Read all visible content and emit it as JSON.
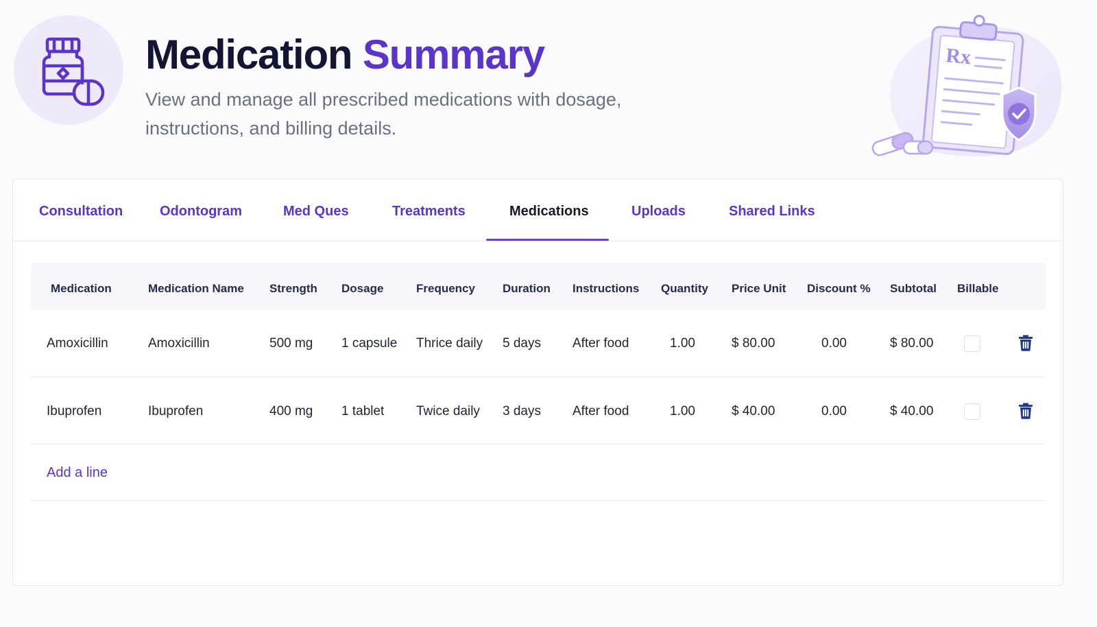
{
  "header": {
    "title_main": "Medication",
    "title_accent": "Summary",
    "subtitle": "View and manage all prescribed medications with dosage, instructions, and billing details.",
    "rx_symbol": "Rx",
    "icons": {
      "badge": "medicine-bottle-icon",
      "illustration": "prescription-clipboard-icon"
    }
  },
  "tabs": [
    {
      "label": "Consultation",
      "active": false
    },
    {
      "label": "Odontogram",
      "active": false
    },
    {
      "label": "Med Ques",
      "active": false
    },
    {
      "label": "Treatments",
      "active": false
    },
    {
      "label": "Medications",
      "active": true
    },
    {
      "label": "Uploads",
      "active": false
    },
    {
      "label": "Shared Links",
      "active": false
    }
  ],
  "table": {
    "columns": [
      "Medication",
      "Medication Name",
      "Strength",
      "Dosage",
      "Frequency",
      "Duration",
      "Instructions",
      "Quantity",
      "Price Unit",
      "Discount %",
      "Subtotal",
      "Billable"
    ],
    "rows": [
      {
        "medication": "Amoxicillin",
        "medication_name": "Amoxicillin",
        "strength": "500 mg",
        "dosage": "1 capsule",
        "frequency": "Thrice daily",
        "duration": "5 days",
        "instructions": "After food",
        "quantity": "1.00",
        "price_unit": "$ 80.00",
        "discount": "0.00",
        "subtotal": "$ 80.00",
        "billable": false
      },
      {
        "medication": "Ibuprofen",
        "medication_name": "Ibuprofen",
        "strength": "400 mg",
        "dosage": "1 tablet",
        "frequency": "Twice daily",
        "duration": "3 days",
        "instructions": "After food",
        "quantity": "1.00",
        "price_unit": "$ 40.00",
        "discount": "0.00",
        "subtotal": "$ 40.00",
        "billable": false
      }
    ],
    "add_line_label": "Add a line",
    "row_action_icon": "trash-icon"
  },
  "colors": {
    "accent": "#5b34c8",
    "title": "#141533",
    "muted": "#6b6f82",
    "delete": "#1f3a8a"
  }
}
